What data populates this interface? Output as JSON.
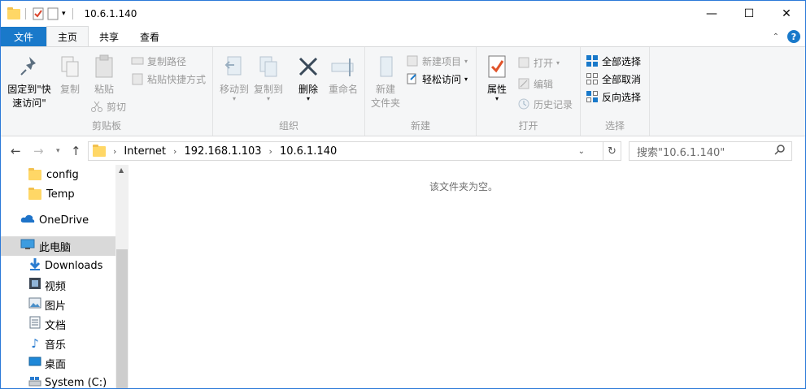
{
  "window": {
    "title": "10.6.1.140",
    "minimize": "—",
    "maximize": "☐",
    "close": "✕"
  },
  "ribbon_tabs": {
    "file": "文件",
    "home": "主页",
    "share": "共享",
    "view": "查看"
  },
  "ribbon": {
    "clipboard": {
      "label": "剪贴板",
      "pin_line1": "固定到\"快",
      "pin_line2": "速访问\"",
      "copy": "复制",
      "paste": "粘贴",
      "copy_path": "复制路径",
      "paste_shortcut": "粘贴快捷方式",
      "cut": "剪切"
    },
    "organize": {
      "label": "组织",
      "move_to": "移动到",
      "copy_to": "复制到",
      "delete": "删除",
      "rename": "重命名"
    },
    "new": {
      "label": "新建",
      "new_folder_line1": "新建",
      "new_folder_line2": "文件夹",
      "new_item": "新建项目",
      "easy_access": "轻松访问"
    },
    "open": {
      "label": "打开",
      "properties": "属性",
      "open": "打开",
      "edit": "编辑",
      "history": "历史记录"
    },
    "select": {
      "label": "选择",
      "select_all": "全部选择",
      "select_none": "全部取消",
      "invert": "反向选择"
    }
  },
  "address": {
    "crumbs": [
      "Internet",
      "192.168.1.103",
      "10.6.1.140"
    ],
    "search_placeholder": "搜索\"10.6.1.140\""
  },
  "nav": {
    "items": [
      "config",
      "Temp",
      "OneDrive",
      "此电脑",
      "Downloads",
      "视频",
      "图片",
      "文档",
      "音乐",
      "桌面",
      "System (C:)"
    ]
  },
  "content": {
    "empty_message": "该文件夹为空。"
  },
  "colors": {
    "accent": "#1979ca",
    "folder": "#ffd766",
    "ribbon_bg": "#f5f6f7"
  }
}
